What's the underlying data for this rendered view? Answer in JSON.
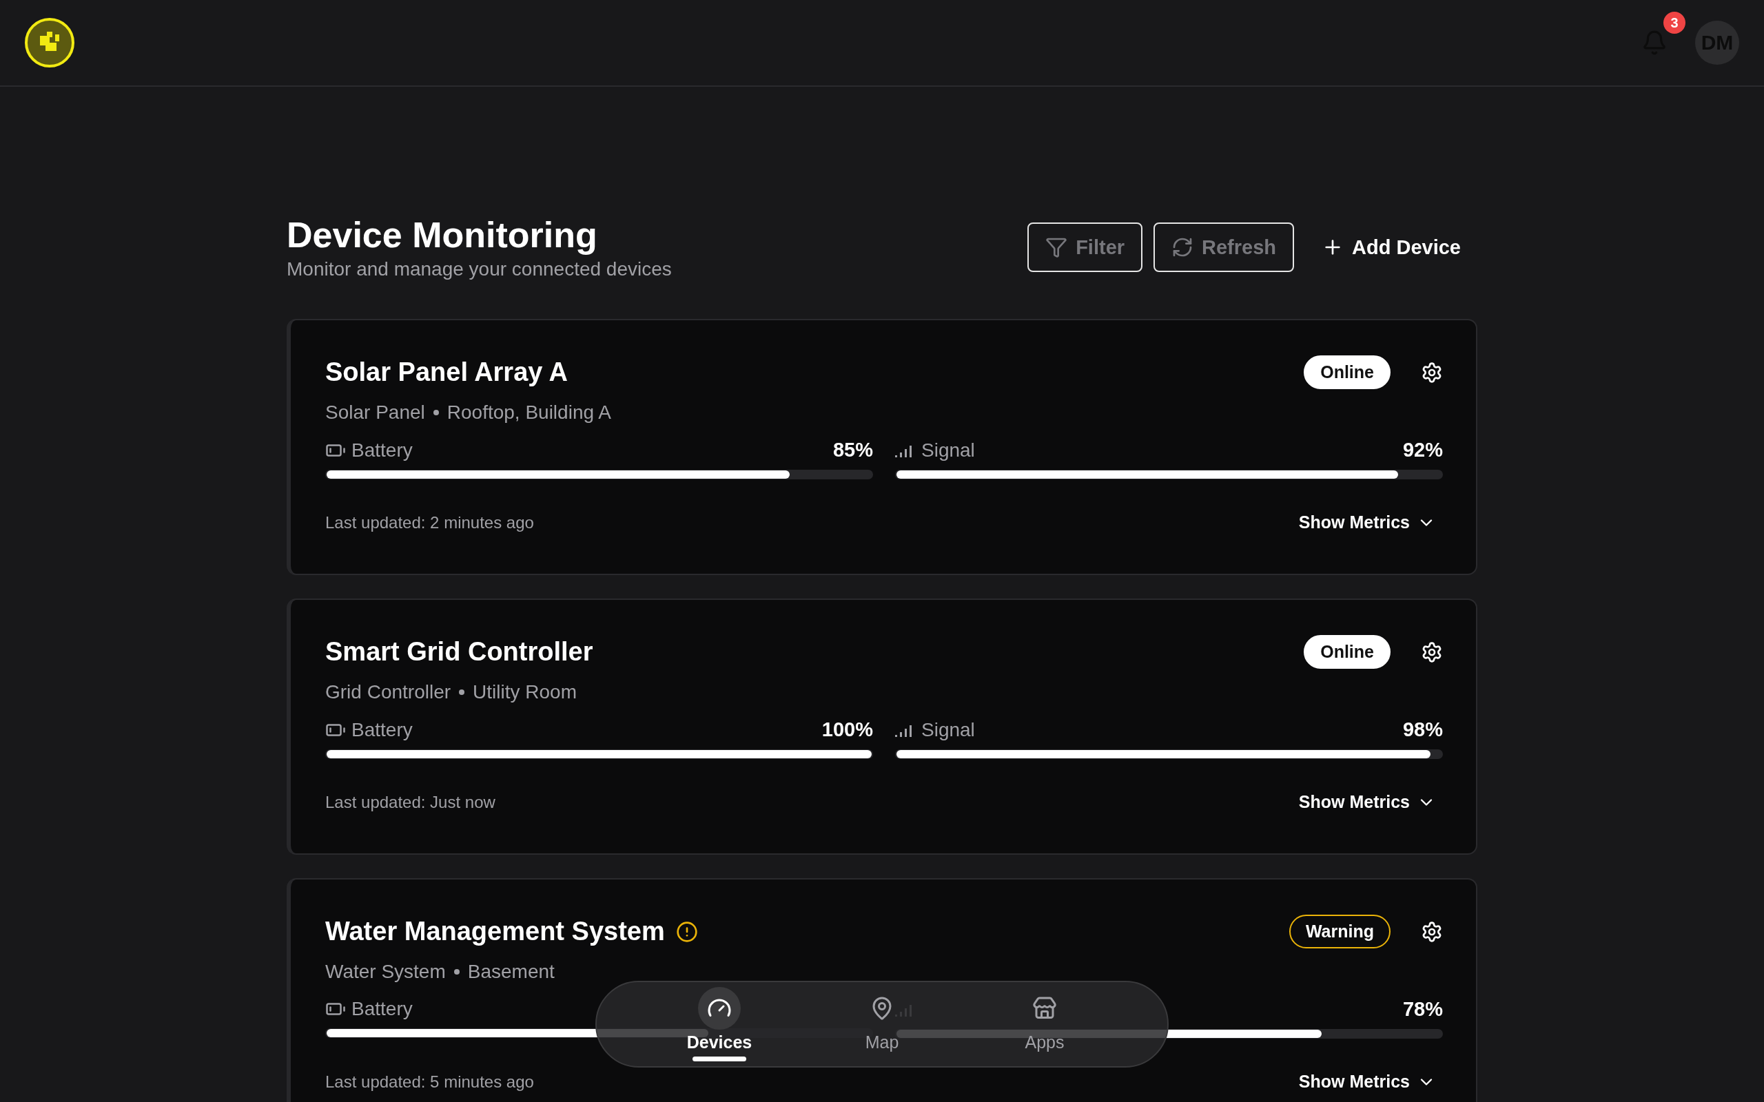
{
  "header": {
    "notifications": {
      "count": "3"
    },
    "avatar": {
      "initials": "DM"
    }
  },
  "page": {
    "title": "Device Monitoring",
    "subtitle": "Monitor and manage your connected devices"
  },
  "actions": [
    {
      "kind": "outline",
      "label": "Filter"
    },
    {
      "kind": "outline",
      "label": "Refresh"
    },
    {
      "kind": "plain",
      "label": "Add Device"
    }
  ],
  "devices": [
    {
      "name": "Solar Panel Array A",
      "warning": false,
      "type": "Solar Panel",
      "location": "Rooftop, Building A",
      "status": {
        "kind": "online",
        "label": "Online"
      },
      "metrics": [
        {
          "kind": "battery",
          "label": "Battery",
          "value": "85%",
          "level": 0.85
        },
        {
          "kind": "signal",
          "label": "Signal",
          "value": "92%",
          "level": 0.92
        }
      ],
      "updated": "Last updated: 2 minutes ago",
      "toggle": "Show Metrics"
    },
    {
      "name": "Smart Grid Controller",
      "warning": false,
      "type": "Grid Controller",
      "location": "Utility Room",
      "status": {
        "kind": "online",
        "label": "Online"
      },
      "metrics": [
        {
          "kind": "battery",
          "label": "Battery",
          "value": "100%",
          "level": 1.0
        },
        {
          "kind": "signal",
          "label": "Signal",
          "value": "98%",
          "level": 0.98
        }
      ],
      "updated": "Last updated: Just now",
      "toggle": "Show Metrics"
    },
    {
      "name": "Water Management System",
      "warning": true,
      "type": "Water System",
      "location": "Basement",
      "status": {
        "kind": "warning",
        "label": "Warning"
      },
      "metrics": [
        {
          "kind": "battery",
          "label": "Battery",
          "level": 0.7
        },
        {
          "kind": "signal",
          "value": "78%",
          "level": 0.78
        }
      ],
      "updated": "Last updated: 5 minutes ago",
      "toggle": "Show Metrics"
    }
  ],
  "nav": [
    {
      "label": "Devices",
      "selected": true
    },
    {
      "label": "Map",
      "selected": false
    },
    {
      "label": "Apps",
      "selected": false
    }
  ]
}
